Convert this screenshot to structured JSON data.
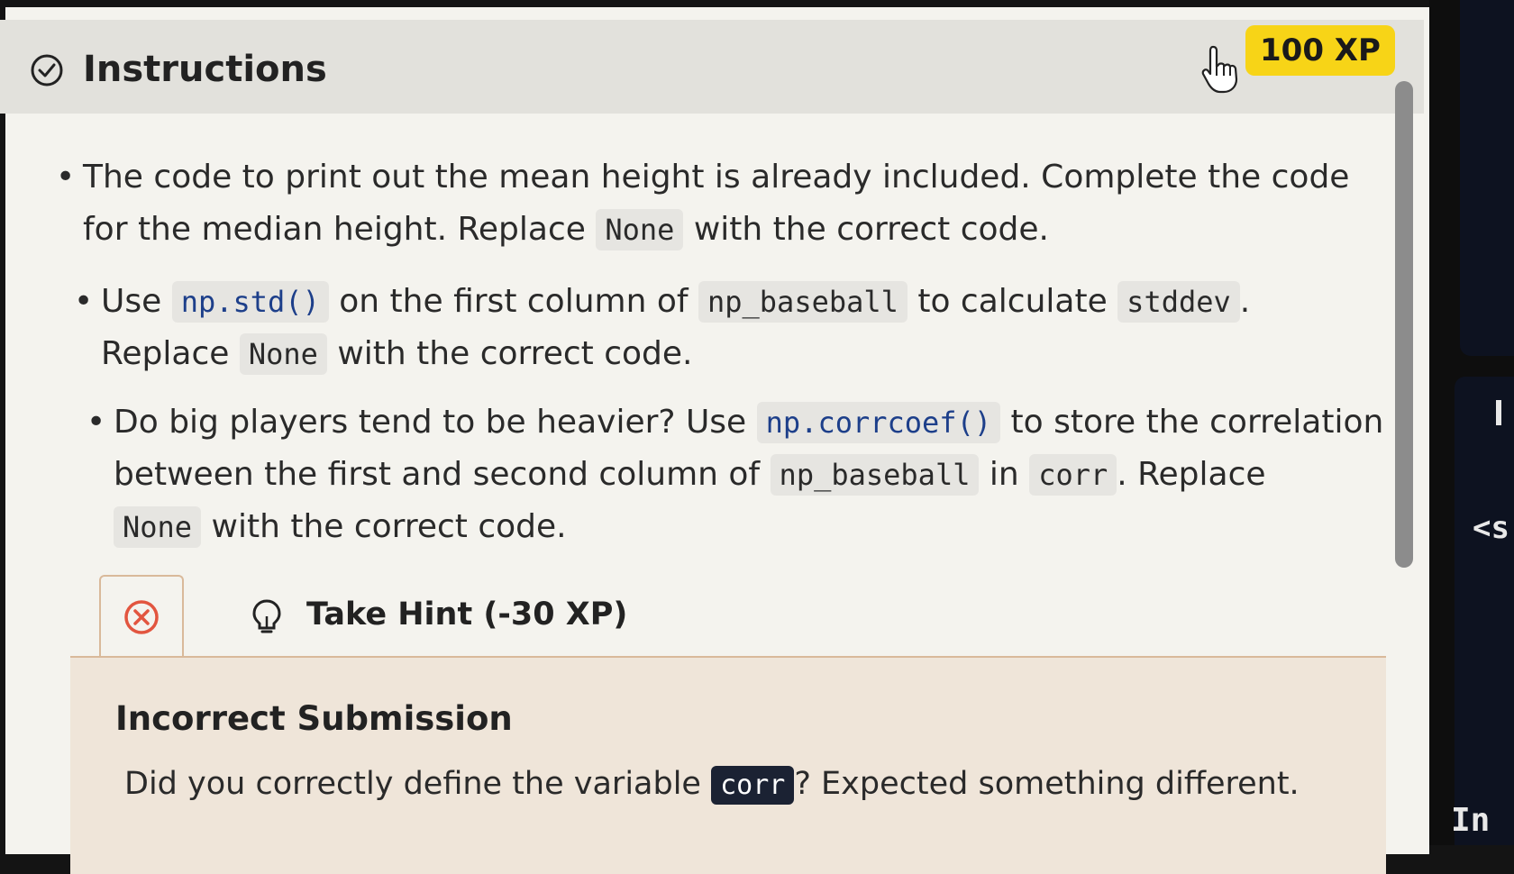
{
  "header": {
    "title": "Instructions",
    "xp": "100 XP"
  },
  "instructions": [
    {
      "parts": [
        "The code to print out the mean height is already included. Complete the code for the median height. Replace ",
        "None",
        " with the correct code."
      ]
    },
    {
      "parts": [
        "Use ",
        "np.std()",
        " on the first column of ",
        "np_baseball",
        " to calculate ",
        "stddev",
        ".",
        "Replace ",
        "None",
        " with the correct code."
      ]
    },
    {
      "parts": [
        "Do big players tend to be heavier? Use ",
        "np.corrcoef()",
        " to store the correlation between the first and second column of ",
        "np_baseball",
        " in ",
        "corr",
        ". Replace",
        "None",
        " with the correct code."
      ]
    }
  ],
  "hint": {
    "label": "Take Hint (-30 XP)"
  },
  "feedback": {
    "title": "Incorrect Submission",
    "msg_before": "Did you correctly define the variable ",
    "code": "corr",
    "msg_after": "? Expected something different."
  },
  "side": {
    "tag_text": "<s",
    "bottom_text": "In"
  },
  "colors": {
    "xp_badge": "#f7d417",
    "error_red": "#e2553f",
    "feedback_bg": "#efe5d9",
    "code_bg": "#e6e5e1",
    "dark_code_bg": "#1b2233"
  }
}
